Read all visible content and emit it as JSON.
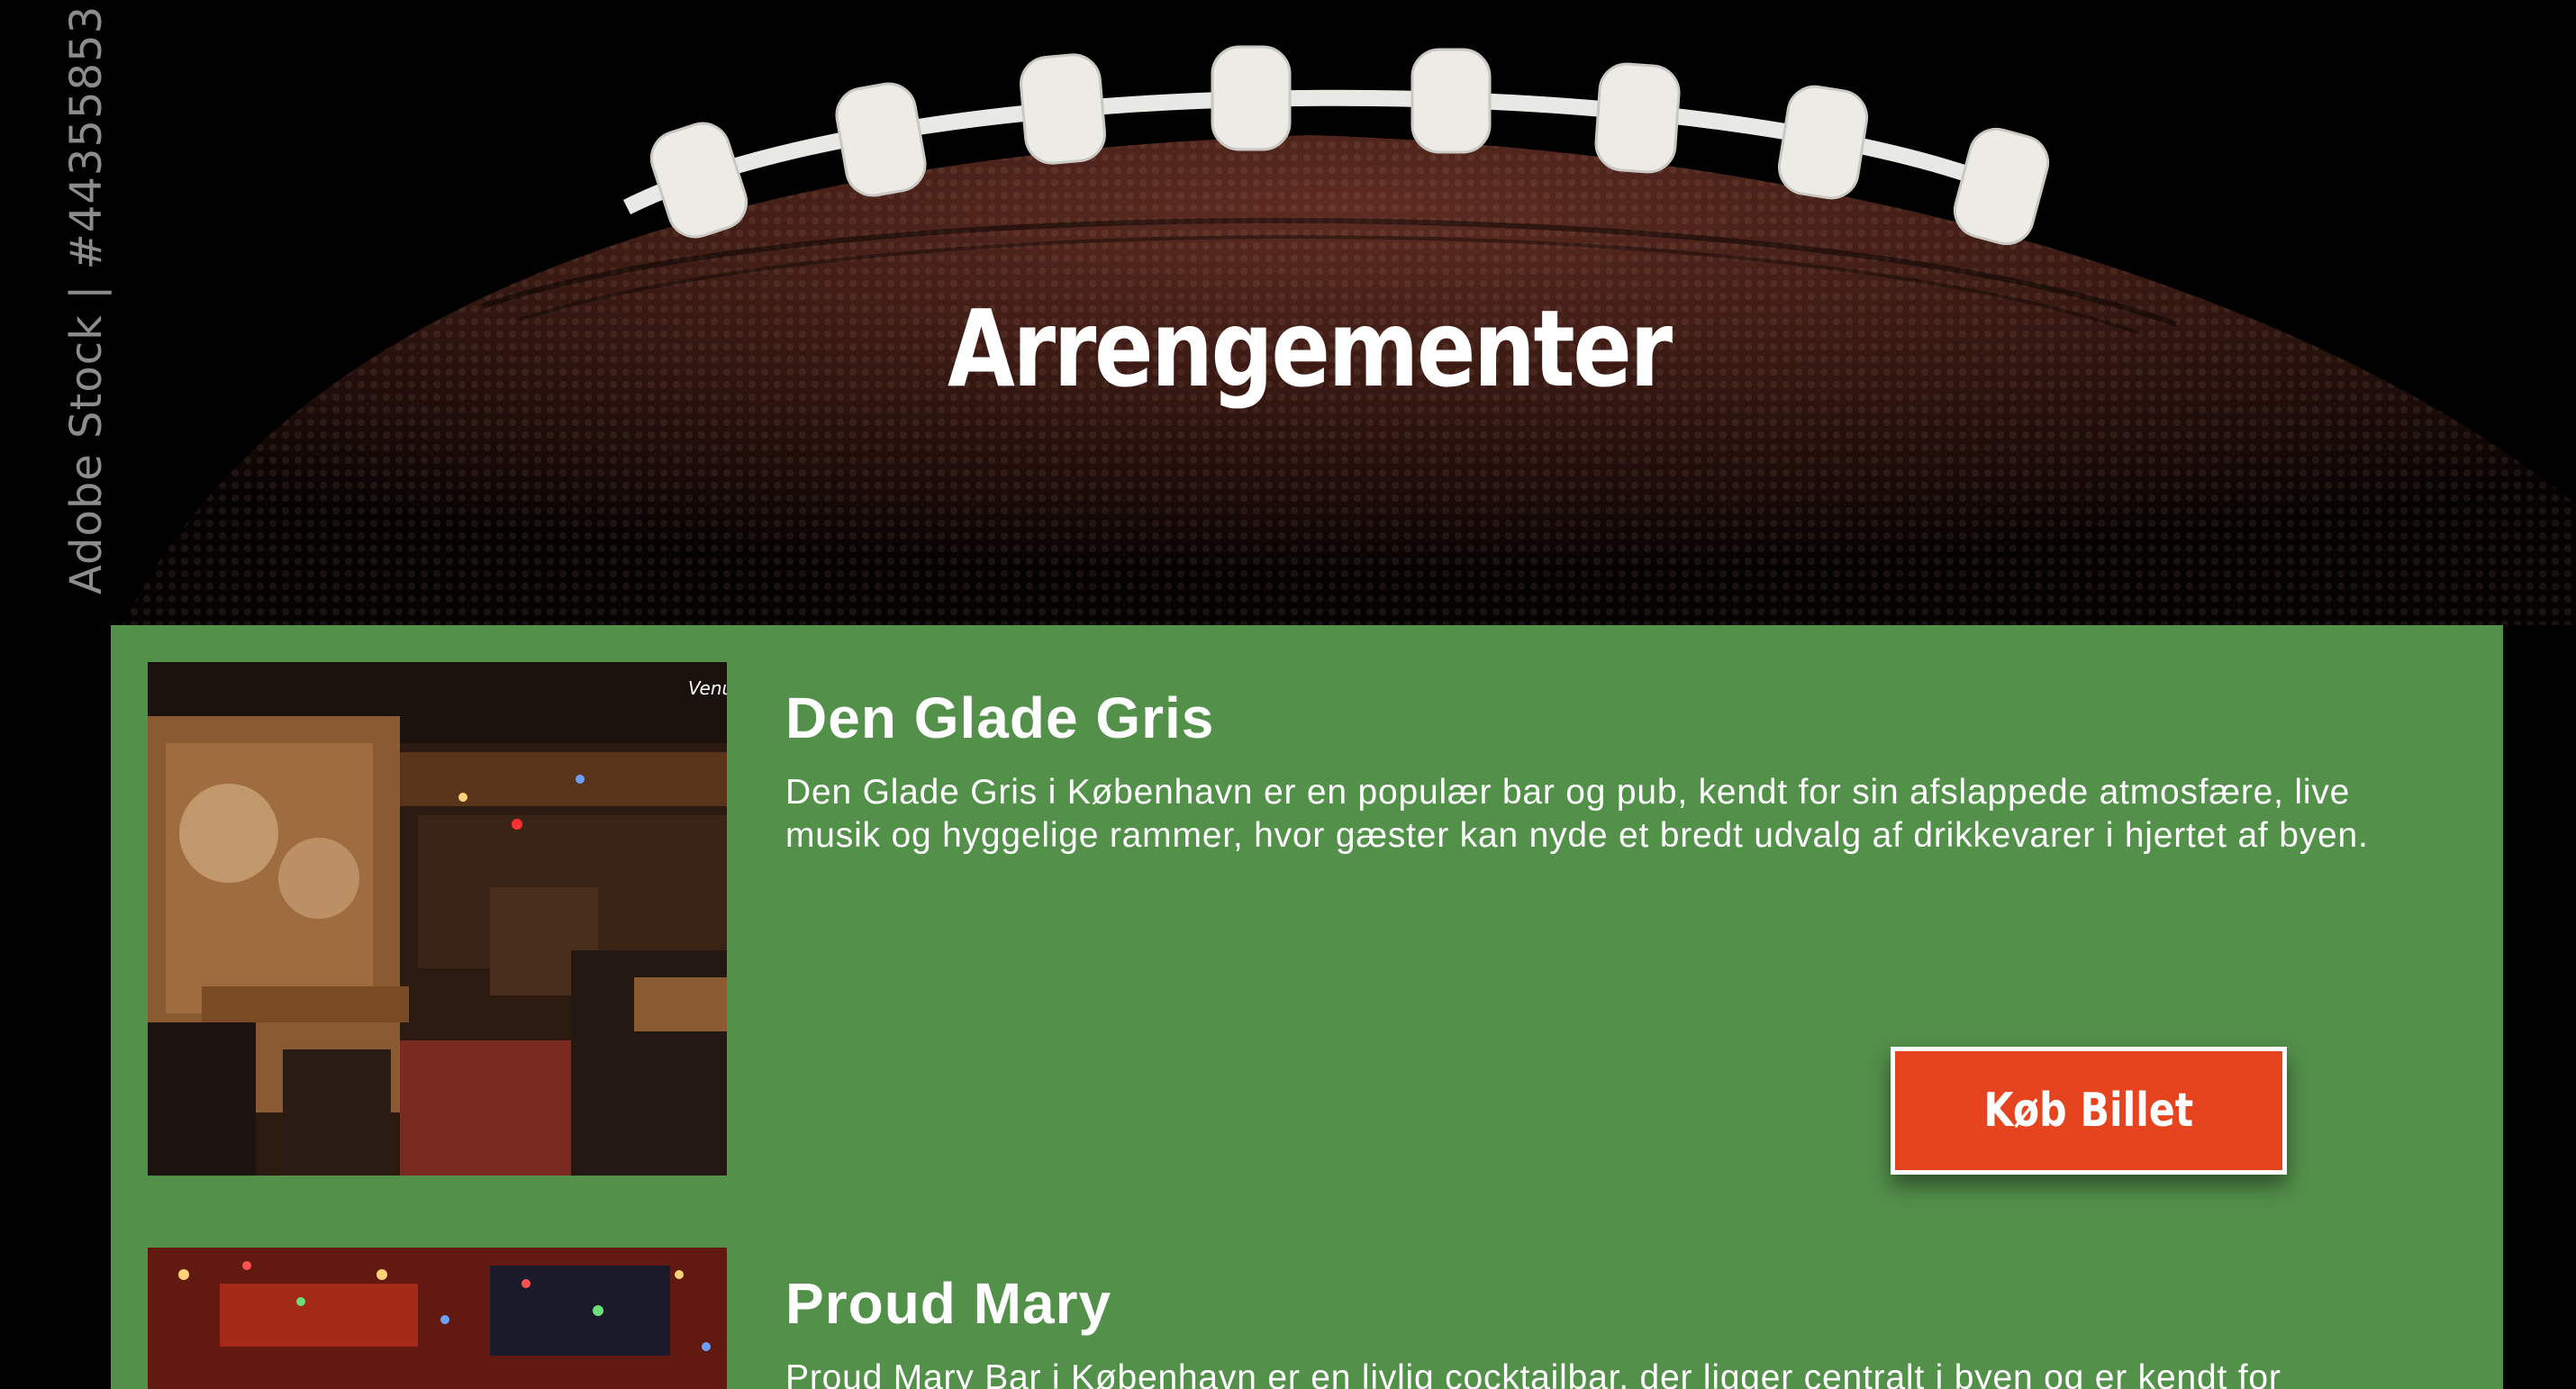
{
  "hero": {
    "title": "Arrengementer",
    "watermark": "Adobe Stock | #44355853"
  },
  "events": [
    {
      "title": "Den Glade Gris",
      "description": "Den Glade Gris i København er en populær bar og pub, kendt for sin afslappede atmosfære, live musik og hyggelige rammer, hvor gæster kan nyde et bredt udvalg af drikkevarer i hjertet af byen.",
      "button": "Køb Billet",
      "image_logo": "Venue"
    },
    {
      "title": "Proud Mary",
      "description": "Proud Mary Bar i København er en livlig cocktailbar, der ligger centralt i byen og er kendt for"
    }
  ],
  "colors": {
    "panel": "#53904a",
    "button": "#e6441f",
    "background": "#000000"
  }
}
